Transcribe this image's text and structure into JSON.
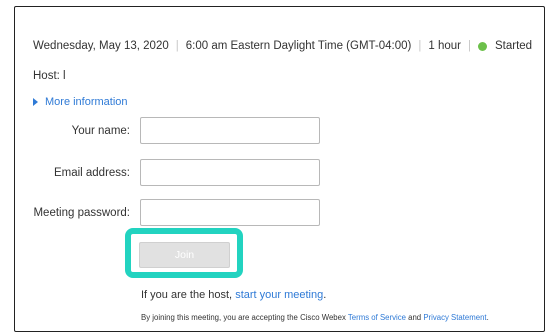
{
  "meeting": {
    "date": "Wednesday, May 13, 2020",
    "time": "6:00 am Eastern Daylight Time (GMT-04:00)",
    "duration": "1 hour",
    "status": "Started",
    "status_color": "#6cc04a",
    "host": "Host: l"
  },
  "more_info": {
    "label": "More information"
  },
  "form": {
    "name_label": "Your name:",
    "name_value": "",
    "email_label": "Email address:",
    "email_value": "",
    "password_label": "Meeting password:",
    "password_value": ""
  },
  "join": {
    "label": "Join",
    "highlight_color": "#22d3c0"
  },
  "host_prompt": {
    "text": "If you are the host,",
    "link": "start your meeting",
    "suffix": "."
  },
  "terms": {
    "prefix": "By joining this meeting, you are accepting the Cisco Webex",
    "tos_link": "Terms of Service",
    "and": "and",
    "privacy_link": "Privacy Statement",
    "suffix": "."
  }
}
